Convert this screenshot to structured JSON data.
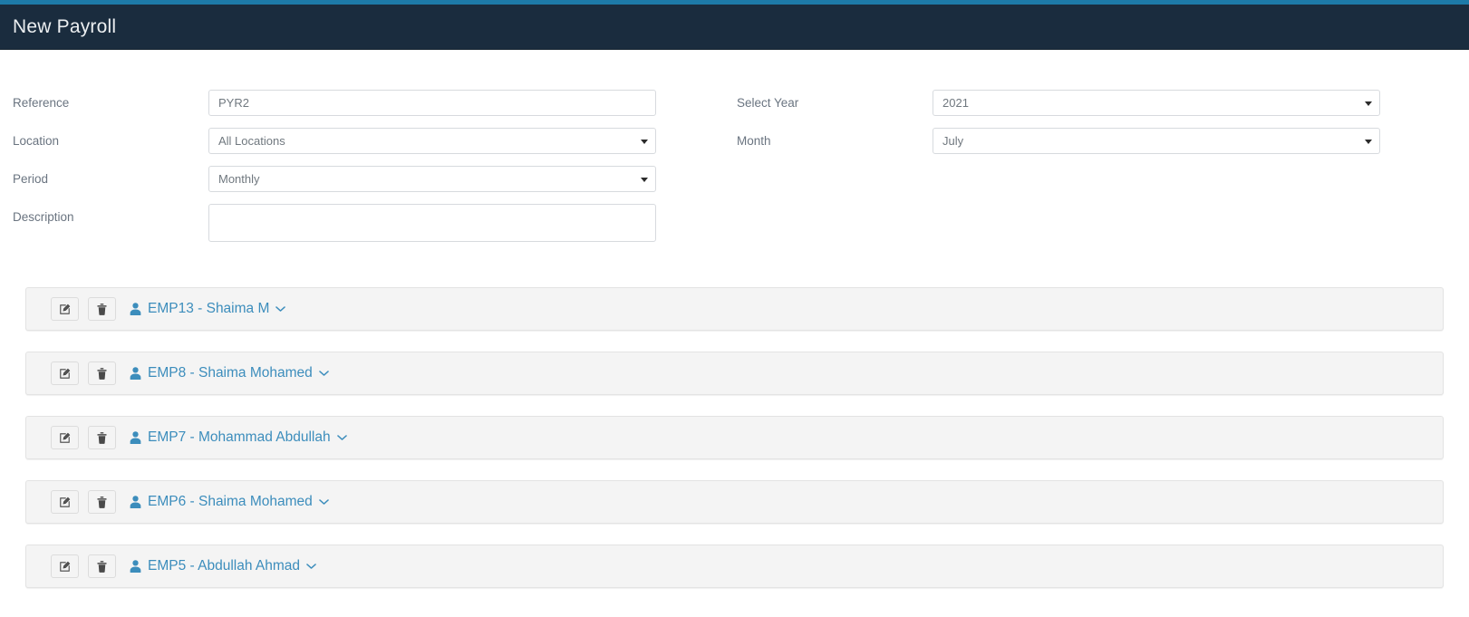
{
  "header": {
    "title": "New Payroll",
    "accent_strip_color": "#1d7aa8",
    "bar_color": "#1a2c3e"
  },
  "form": {
    "left": [
      {
        "label": "Reference",
        "type": "text",
        "value": "PYR2",
        "placeholder": "",
        "name": "reference"
      },
      {
        "label": "Location",
        "type": "select",
        "value": "All Locations",
        "placeholder": "",
        "name": "location"
      },
      {
        "label": "Period",
        "type": "select",
        "value": "Monthly",
        "placeholder": "",
        "name": "period"
      },
      {
        "label": "Description",
        "type": "textarea",
        "value": "",
        "placeholder": "",
        "name": "description"
      }
    ],
    "right": [
      {
        "label": "Select Year",
        "type": "select",
        "value": "2021",
        "placeholder": "",
        "name": "select-year"
      },
      {
        "label": "Month",
        "type": "select",
        "value": "July",
        "placeholder": "",
        "name": "month"
      }
    ]
  },
  "employees": {
    "link_color": "#3c8dbc",
    "row_bg": "#f4f4f4",
    "edit_icon": "edit-pencil-square-icon",
    "delete_icon": "trash-icon",
    "person_icon": "person-icon",
    "expand_icon": "chevron-down-icon",
    "rows": [
      {
        "label": "EMP13 - Shaima M"
      },
      {
        "label": "EMP8 - Shaima Mohamed"
      },
      {
        "label": "EMP7 - Mohammad Abdullah"
      },
      {
        "label": "EMP6 - Shaima Mohamed"
      },
      {
        "label": "EMP5 - Abdullah Ahmad"
      }
    ]
  }
}
